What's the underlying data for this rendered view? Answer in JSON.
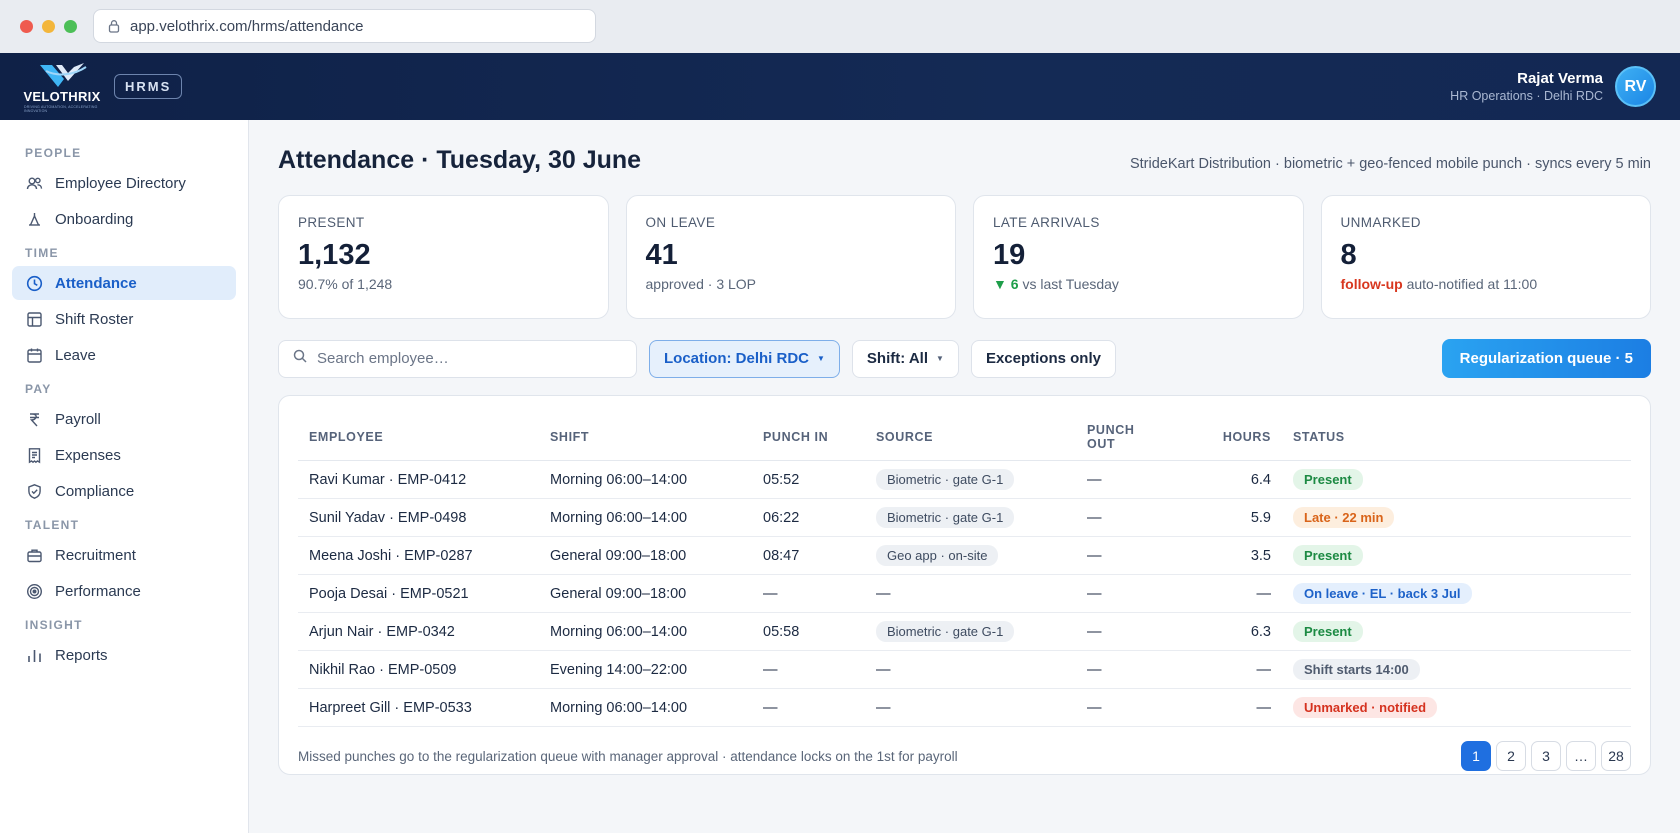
{
  "browser": {
    "url": "app.velothrix.com/hrms/attendance"
  },
  "header": {
    "logo_text": "VELOTHRIX",
    "logo_tagline": "DRIVING AUTOMATION, ACCELERATING INNOVATION",
    "product_badge": "HRMS",
    "user": {
      "name": "Rajat Verma",
      "role": "HR Operations · Delhi RDC",
      "initials": "RV"
    }
  },
  "sidebar": {
    "sections": [
      {
        "label": "PEOPLE",
        "items": [
          {
            "label": "Employee Directory",
            "icon": "users-icon"
          },
          {
            "label": "Onboarding",
            "icon": "onboarding-icon"
          }
        ]
      },
      {
        "label": "TIME",
        "items": [
          {
            "label": "Attendance",
            "icon": "clock-icon",
            "active": true
          },
          {
            "label": "Shift Roster",
            "icon": "grid-icon"
          },
          {
            "label": "Leave",
            "icon": "calendar-icon"
          }
        ]
      },
      {
        "label": "PAY",
        "items": [
          {
            "label": "Payroll",
            "icon": "rupee-icon"
          },
          {
            "label": "Expenses",
            "icon": "receipt-icon"
          },
          {
            "label": "Compliance",
            "icon": "shield-icon"
          }
        ]
      },
      {
        "label": "TALENT",
        "items": [
          {
            "label": "Recruitment",
            "icon": "briefcase-icon"
          },
          {
            "label": "Performance",
            "icon": "target-icon"
          }
        ]
      },
      {
        "label": "INSIGHT",
        "items": [
          {
            "label": "Reports",
            "icon": "bar-chart-icon"
          }
        ]
      }
    ]
  },
  "page": {
    "title": "Attendance · Tuesday, 30 June",
    "subtitle": "StrideKart Distribution · biometric + geo-fenced mobile punch · syncs every 5 min"
  },
  "kpis": [
    {
      "label": "PRESENT",
      "value": "1,132",
      "sub": "90.7% of 1,248"
    },
    {
      "label": "ON LEAVE",
      "value": "41",
      "sub": "approved · 3 LOP"
    },
    {
      "label": "LATE ARRIVALS",
      "value": "19",
      "sub_highlight": "6",
      "sub": "vs last Tuesday"
    },
    {
      "label": "UNMARKED",
      "value": "8",
      "sub_highlight": "follow-up",
      "sub": "auto-notified at 11:00"
    }
  ],
  "toolbar": {
    "search_placeholder": "Search employee…",
    "location_filter": "Location: Delhi RDC",
    "shift_filter": "Shift: All",
    "exceptions_toggle": "Exceptions only",
    "queue_button": "Regularization queue · 5"
  },
  "table": {
    "columns": [
      "EMPLOYEE",
      "SHIFT",
      "PUNCH IN",
      "SOURCE",
      "PUNCH OUT",
      "HOURS",
      "STATUS"
    ],
    "rows": [
      {
        "employee": "Ravi Kumar · EMP-0412",
        "shift": "Morning 06:00–14:00",
        "punch_in": "05:52",
        "source": "Biometric · gate G-1",
        "punch_out": "—",
        "hours": "6.4",
        "status": "Present",
        "status_type": "present"
      },
      {
        "employee": "Sunil Yadav · EMP-0498",
        "shift": "Morning 06:00–14:00",
        "punch_in": "06:22",
        "source": "Biometric · gate G-1",
        "punch_out": "—",
        "hours": "5.9",
        "status": "Late · 22 min",
        "status_type": "late"
      },
      {
        "employee": "Meena Joshi · EMP-0287",
        "shift": "General 09:00–18:00",
        "punch_in": "08:47",
        "source": "Geo app · on-site",
        "punch_out": "—",
        "hours": "3.5",
        "status": "Present",
        "status_type": "present"
      },
      {
        "employee": "Pooja Desai · EMP-0521",
        "shift": "General 09:00–18:00",
        "punch_in": "—",
        "source": "—",
        "punch_out": "—",
        "hours": "—",
        "status": "On leave · EL · back 3 Jul",
        "status_type": "leave"
      },
      {
        "employee": "Arjun Nair · EMP-0342",
        "shift": "Morning 06:00–14:00",
        "punch_in": "05:58",
        "source": "Biometric · gate G-1",
        "punch_out": "—",
        "hours": "6.3",
        "status": "Present",
        "status_type": "present"
      },
      {
        "employee": "Nikhil Rao · EMP-0509",
        "shift": "Evening 14:00–22:00",
        "punch_in": "—",
        "source": "—",
        "punch_out": "—",
        "hours": "—",
        "status": "Shift starts 14:00",
        "status_type": "shift"
      },
      {
        "employee": "Harpreet Gill · EMP-0533",
        "shift": "Morning 06:00–14:00",
        "punch_in": "—",
        "source": "—",
        "punch_out": "—",
        "hours": "—",
        "status": "Unmarked · notified",
        "status_type": "unmarked"
      }
    ],
    "footnote": "Missed punches go to the regularization queue with manager approval · attendance locks on the 1st for payroll",
    "pagination": [
      "1",
      "2",
      "3",
      "…",
      "28"
    ],
    "current_page": "1"
  },
  "colors": {
    "nav_bg": "#0f2147",
    "accent": "#1f6fe0",
    "present": "#1c8a43",
    "late": "#d9641a",
    "leave": "#1e62c9",
    "unmarked": "#d5321f"
  }
}
